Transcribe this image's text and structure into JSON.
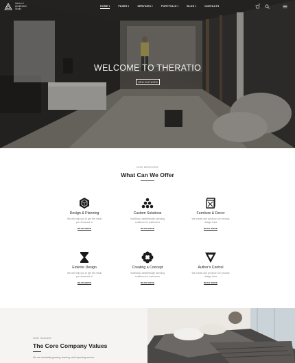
{
  "brand": {
    "name_lines": [
      "Interior &",
      "Architecture",
      "Studio"
    ]
  },
  "nav": {
    "items": [
      {
        "label": "HOME",
        "has_caret": true,
        "active": true
      },
      {
        "label": "PAGES",
        "has_caret": true,
        "active": false
      },
      {
        "label": "SERVICES",
        "has_caret": true,
        "active": false
      },
      {
        "label": "PORTFOLIO",
        "has_caret": true,
        "active": false
      },
      {
        "label": "BLOG",
        "has_caret": true,
        "active": false
      },
      {
        "label": "CONTACTS",
        "has_caret": false,
        "active": false
      }
    ],
    "cart_count": "0"
  },
  "hero": {
    "title": "WELCOME TO THERATIO",
    "button_label": "VIEW OUR WORK"
  },
  "offer": {
    "pretitle": "OUR SERVICES",
    "title": "What Can We Offer",
    "services": [
      {
        "icon": "cube-icon",
        "name": "Design & Planning",
        "desc": "We will help you to get the result you dreamed of",
        "more": "READ MORE"
      },
      {
        "icon": "triangle-dots-icon",
        "name": "Custom Solutions",
        "desc": "Individual, aesthetically stunning solutions for customers",
        "more": "READ MORE"
      },
      {
        "icon": "box-icon",
        "name": "Furniture & Decor",
        "desc": "We create and produce our product design lines",
        "more": "READ MORE"
      },
      {
        "icon": "hourglass-icon",
        "name": "Exterior Design",
        "desc": "We will help you to get the result you dreamed of",
        "more": "READ MORE"
      },
      {
        "icon": "flower-icon",
        "name": "Creating a Concept",
        "desc": "Individual, aesthetically stunning solutions for customers",
        "more": "READ MORE"
      },
      {
        "icon": "triangle-icon",
        "name": "Author's Control",
        "desc": "We create and produce our product design lines",
        "more": "READ MORE"
      }
    ]
  },
  "core": {
    "pretitle": "OUR VALUES",
    "title": "The Core Company Values",
    "text": "We are constantly growing, learning, and improving and our"
  }
}
